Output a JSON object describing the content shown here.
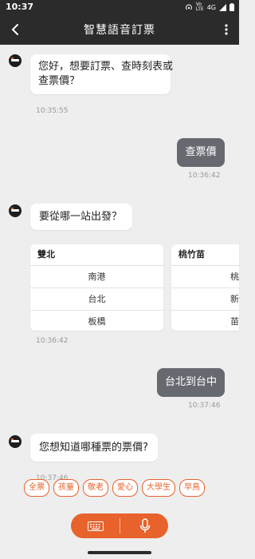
{
  "status": {
    "time": "10:37",
    "net": "4G"
  },
  "header": {
    "title": "智慧語音訂票"
  },
  "messages": {
    "bot1_line1": "您好，想要訂票、查時刻表或",
    "bot1_line2": "查票價？",
    "bot1_time": "10:35:55",
    "user1": "查票價",
    "user1_time": "10:36:42",
    "bot2": "要從哪一站出發？",
    "bot2_time": "10:36:42",
    "user2": "台北到台中",
    "user2_time": "10:37:46",
    "bot3": "您想知道哪種票的票價?",
    "bot3_time": "10:37:46"
  },
  "station_cards": [
    {
      "header": "雙北",
      "stations": [
        "南港",
        "台北",
        "板橋"
      ]
    },
    {
      "header": "桃竹苗",
      "stations": [
        "桃",
        "新",
        "苗"
      ]
    }
  ],
  "ticket_chips": [
    "全票",
    "孩童",
    "敬老",
    "愛心",
    "大學生",
    "早鳥"
  ],
  "input": {
    "keyboard_icon": "keyboard-icon",
    "mic_icon": "microphone-icon"
  },
  "colors": {
    "accent": "#e8622c",
    "bar": "#2b2b2b",
    "user_bubble": "#666a70"
  }
}
